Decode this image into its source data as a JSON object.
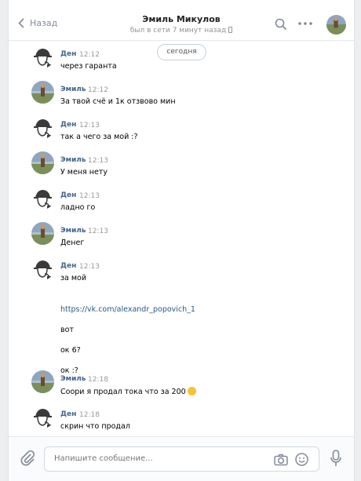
{
  "header": {
    "back_label": "Назад",
    "title": "Эмиль Микулов",
    "subtitle": "был в сети 7 минут назад"
  },
  "date_divider": "сегодня",
  "messages": [
    {
      "author": "Ден",
      "time": "12:12",
      "avatar": "detective",
      "lines": [
        "через гаранта"
      ]
    },
    {
      "author": "Эмиль",
      "time": "12:12",
      "avatar": "landscape",
      "lines": [
        "За твой счё и 1к отзвово мин"
      ]
    },
    {
      "author": "Ден",
      "time": "12:13",
      "avatar": "detective",
      "lines": [
        "так а чего за мой :?"
      ]
    },
    {
      "author": "Эмиль",
      "time": "12:13",
      "avatar": "landscape",
      "lines": [
        "У меня нету"
      ]
    },
    {
      "author": "Ден",
      "time": "12:13",
      "avatar": "detective",
      "lines": [
        "ладно го"
      ]
    },
    {
      "author": "Эмиль",
      "time": "12:13",
      "avatar": "landscape",
      "lines": [
        "Денег"
      ]
    },
    {
      "author": "Ден",
      "time": "12:13",
      "avatar": "detective",
      "lines": [
        "за мой",
        "https://vk.com/alexandr_popovich_1",
        "вот",
        "ок 6?",
        "ок :?"
      ]
    },
    {
      "author": "Эмиль",
      "time": "12:18",
      "avatar": "landscape",
      "lines": [
        "Соори я продал тока что за 200"
      ]
    },
    {
      "author": "Ден",
      "time": "12:18",
      "avatar": "detective",
      "lines": [
        "скрин что продал"
      ]
    }
  ],
  "composer": {
    "placeholder": "Напишите сообщение..."
  },
  "colors": {
    "name": "#42648b",
    "link": "#2a5885",
    "time": "#999999",
    "background": "#edeef0"
  }
}
